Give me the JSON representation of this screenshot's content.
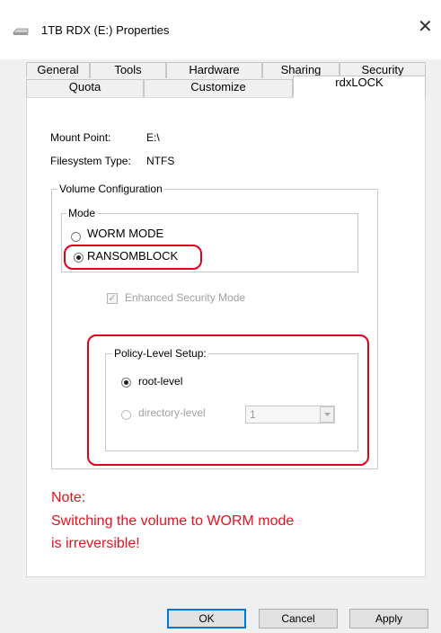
{
  "window": {
    "title": "1TB RDX (E:) Properties",
    "close_symbol": "✕"
  },
  "tabs": {
    "row1": [
      "General",
      "Tools",
      "Hardware",
      "Sharing",
      "Security"
    ],
    "row2": [
      "Quota",
      "Customize",
      "rdxLOCK"
    ],
    "active": "rdxLOCK"
  },
  "info": {
    "mount_point_label": "Mount Point:",
    "mount_point_value": "E:\\",
    "filesystem_label": "Filesystem Type:",
    "filesystem_value": "NTFS"
  },
  "volume_config": {
    "legend": "Volume Configuration",
    "mode_legend": "Mode",
    "worm_label": "WORM MODE",
    "ransomblock_label": "RANSOMBLOCK",
    "selected_mode": "RANSOMBLOCK",
    "enhanced_label": "Enhanced Security Mode",
    "enhanced_checked": true,
    "enhanced_disabled": true
  },
  "policy": {
    "legend": "Policy-Level Setup:",
    "root_label": "root-level",
    "directory_label": "directory-level",
    "selected": "root-level",
    "directory_value": "1"
  },
  "note": {
    "line1": "Note:",
    "line2": "Switching the volume to WORM mode",
    "line3": "is irreversible!"
  },
  "buttons": {
    "ok": "OK",
    "cancel": "Cancel",
    "apply": "Apply"
  },
  "colors": {
    "highlight": "#e3001b",
    "note_text": "#e8101e",
    "default_button_border": "#0078d7"
  }
}
